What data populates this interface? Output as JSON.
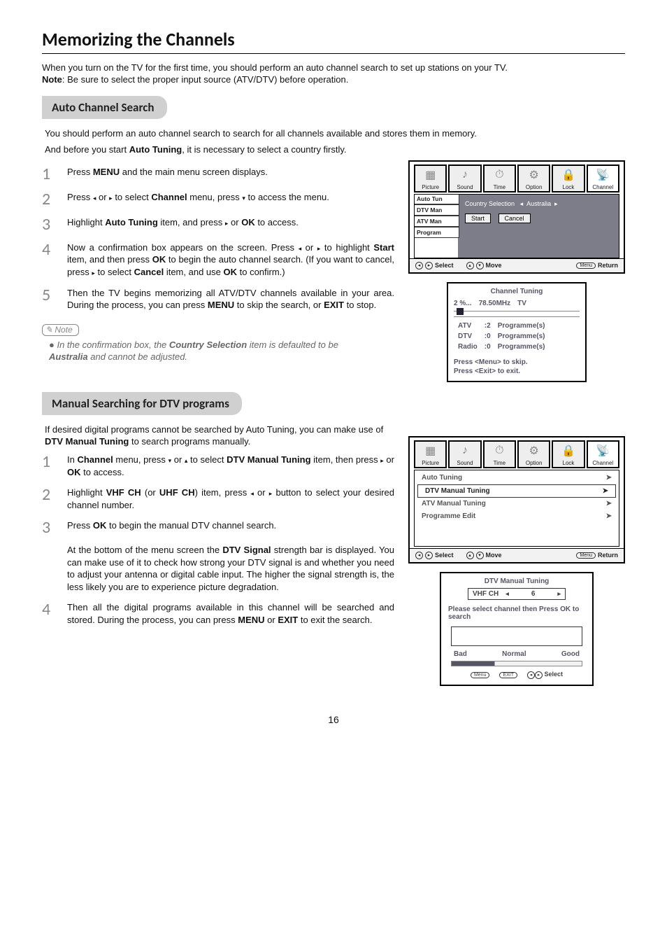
{
  "page_title": "Memorizing the Channels",
  "intro_1": "When you turn on the TV for the first time, you should perform an auto channel search to set up stations on your TV.",
  "intro_note_label": "Note",
  "intro_note_text": ":  Be sure to select the proper input source (ATV/DTV) before operation.",
  "section1": {
    "title": "Auto Channel Search",
    "intro_a": "You should perform an auto channel search to search for all channels available and stores them in memory.",
    "intro_b_pre": "And before you start ",
    "intro_b_bold": "Auto Tuning",
    "intro_b_post": ", it is necessary to select a country firstly.",
    "steps": {
      "s1_a": "Press ",
      "s1_b": "MENU",
      "s1_c": " and the main menu screen displays.",
      "s2_a": "Press ",
      "s2_b": " or ",
      "s2_c": " to select ",
      "s2_d": "Channel",
      "s2_e": " menu,  press ",
      "s2_f": " to access the menu.",
      "s3_a": "Highlight ",
      "s3_b": "Auto Tuning",
      "s3_c": " item, and press  ",
      "s3_d": " or ",
      "s3_e": "OK",
      "s3_f": " to access.",
      "s4_a": "Now a confirmation box appears on the screen. Press ",
      "s4_b": " or ",
      "s4_c": " to highlight ",
      "s4_d": "Start",
      "s4_e": " item, and then press ",
      "s4_f": "OK",
      "s4_g": " to begin the auto channel search. (If you want to cancel, press  ",
      "s4_h": " to select ",
      "s4_i": "Cancel",
      "s4_j": " item, and use ",
      "s4_k": "OK",
      "s4_l": "  to confirm.)",
      "s5_a": "Then the TV begins memorizing all ATV/DTV channels available in your area. During the process, you can press ",
      "s5_b": "MENU",
      "s5_c": " to skip the search, or ",
      "s5_d": "EXIT",
      "s5_e": " to stop."
    },
    "note_label": "Note",
    "note_a": "In the confirmation box, the ",
    "note_b": "Country Selection",
    "note_c": " item is defaulted to be ",
    "note_d": "Australia",
    "note_e": " and cannot be adjusted."
  },
  "osd_a": {
    "tabs": [
      "Picture",
      "Sound",
      "Time",
      "Option",
      "Lock",
      "Channel"
    ],
    "submenu": [
      "Auto Tun",
      "DTV Man",
      "ATV Man",
      "Program"
    ],
    "country_label": "Country Selection",
    "country_value": "Australia",
    "buttons": {
      "start": "Start",
      "cancel": "Cancel"
    },
    "footer": {
      "select": "Select",
      "move": "Move",
      "return": "Return",
      "menu": "Menu"
    }
  },
  "popup_tuning": {
    "title": "Channel  Tuning",
    "progress_pct": "2  %...",
    "freq": "78.50MHz",
    "mode": "TV",
    "rows": [
      {
        "k": "ATV",
        "n": ":2",
        "v": "Programme(s)"
      },
      {
        "k": "DTV",
        "n": ":0",
        "v": "Programme(s)"
      },
      {
        "k": "Radio",
        "n": ":0",
        "v": "Programme(s)"
      }
    ],
    "msg1": "Press <Menu> to skip.",
    "msg2": "Press <Exit> to exit."
  },
  "section2": {
    "title": "Manual Searching for DTV programs",
    "intro_a": "If desired digital programs cannot be searched by Auto Tuning, you can make use of ",
    "intro_b": "DTV Manual Tuning",
    "intro_c": " to search programs manually.",
    "steps": {
      "s1_a": "In ",
      "s1_b": "Channel",
      "s1_c": " menu,  press ",
      "s1_d": " or ",
      "s1_e": "  to select ",
      "s1_f": "DTV Manual Tuning",
      "s1_g": " item, then press ",
      "s1_h": " or ",
      "s1_i": "OK",
      "s1_j": " to access.",
      "s2_a": "Highlight ",
      "s2_b": "VHF CH",
      "s2_c": " (or ",
      "s2_d": "UHF CH",
      "s2_e": ") item, press ",
      "s2_f": " or ",
      "s2_g": " button to select your desired channel number.",
      "s3_a": "Press ",
      "s3_b": "OK",
      "s3_c": " to begin the manual DTV  channel search.",
      "s3_d": "At the bottom of the menu screen the ",
      "s3_e": "DTV Signal",
      "s3_f": " strength bar is displayed. You can make use of it to check how strong your DTV signal is and whether you need to adjust your antenna or digital cable input. The higher the signal strength is, the less likely you are to experience picture degradation.",
      "s4_a": "Then all the digital programs available in this channel will be searched and stored. During the process, you can press ",
      "s4_b": "MENU",
      "s4_c": " or ",
      "s4_d": "EXIT",
      "s4_e": " to exit the search."
    }
  },
  "osd_b": {
    "tabs": [
      "Picture",
      "Sound",
      "Time",
      "Option",
      "Lock",
      "Channel"
    ],
    "items": [
      "Auto Tuning",
      "DTV Manual Tuning",
      "ATV Manual Tuning",
      "Programme Edit"
    ],
    "footer": {
      "select": "Select",
      "move": "Move",
      "return": "Return",
      "menu": "Menu"
    }
  },
  "popup_dtv": {
    "title": "DTV Manual Tuning",
    "ch_label": "VHF  CH",
    "ch_value": "6",
    "info": "Please select channel then Press OK to search",
    "sig": {
      "bad": "Bad",
      "normal": "Normal",
      "good": "Good"
    },
    "footer": {
      "menu": "Menu",
      "exit": "EXIT",
      "select": "Select"
    }
  },
  "page_number": "16"
}
